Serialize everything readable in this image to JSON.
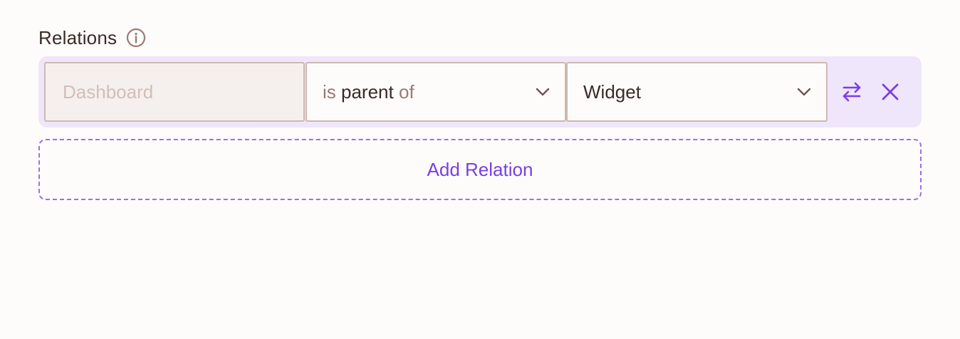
{
  "relations": {
    "title": "Relations",
    "info_icon": "info-icon",
    "rows": [
      {
        "source": "Dashboard",
        "relation": {
          "prefix": "is",
          "middle": "parent",
          "suffix": "of"
        },
        "target": "Widget"
      }
    ],
    "add_label": "Add Relation"
  },
  "colors": {
    "accent": "#7a3fe0",
    "row_background": "#efe6fb",
    "field_border": "#cdb9b0",
    "text": "#3a2a26",
    "muted_text": "#9a7b71"
  },
  "icons": {
    "swap": "swap-arrows-icon",
    "remove": "close-icon",
    "dropdown": "chevron-down-icon"
  }
}
